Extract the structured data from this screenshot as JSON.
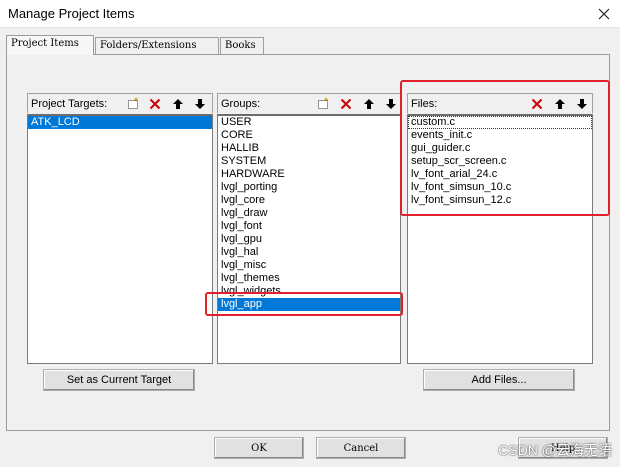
{
  "window": {
    "title": "Manage Project Items"
  },
  "tabs": [
    {
      "label": "Project Items"
    },
    {
      "label": "Folders/Extensions"
    },
    {
      "label": "Books"
    }
  ],
  "targets": {
    "label": "Project Targets:",
    "items": [
      "ATK_LCD"
    ],
    "selected": "ATK_LCD"
  },
  "groups": {
    "label": "Groups:",
    "items": [
      "USER",
      "CORE",
      "HALLIB",
      "SYSTEM",
      "HARDWARE",
      "lvgl_porting",
      "lvgl_core",
      "lvgl_draw",
      "lvgl_font",
      "lvgl_gpu",
      "lvgl_hal",
      "lvgl_misc",
      "lvgl_themes",
      "lvgl_widgets",
      "lvgl_app"
    ],
    "selected": "lvgl_app"
  },
  "files": {
    "label": "Files:",
    "items": [
      "custom.c",
      "events_init.c",
      "gui_guider.c",
      "setup_scr_screen.c",
      "lv_font_arial_24.c",
      "lv_font_simsun_10.c",
      "lv_font_simsun_12.c"
    ],
    "focused": "custom.c"
  },
  "buttons": {
    "set_current_target": "Set as Current Target",
    "add_files": "Add Files...",
    "ok": "OK",
    "cancel": "Cancel",
    "help": "Help"
  },
  "watermark": "CSDN @云海无语",
  "colors": {
    "selection": "#0078d7",
    "annotation": "#e0202a",
    "delete_icon": "#cc0000"
  },
  "icons": [
    "new-item-icon",
    "delete-icon",
    "move-up-icon",
    "move-down-icon",
    "close-icon"
  ]
}
